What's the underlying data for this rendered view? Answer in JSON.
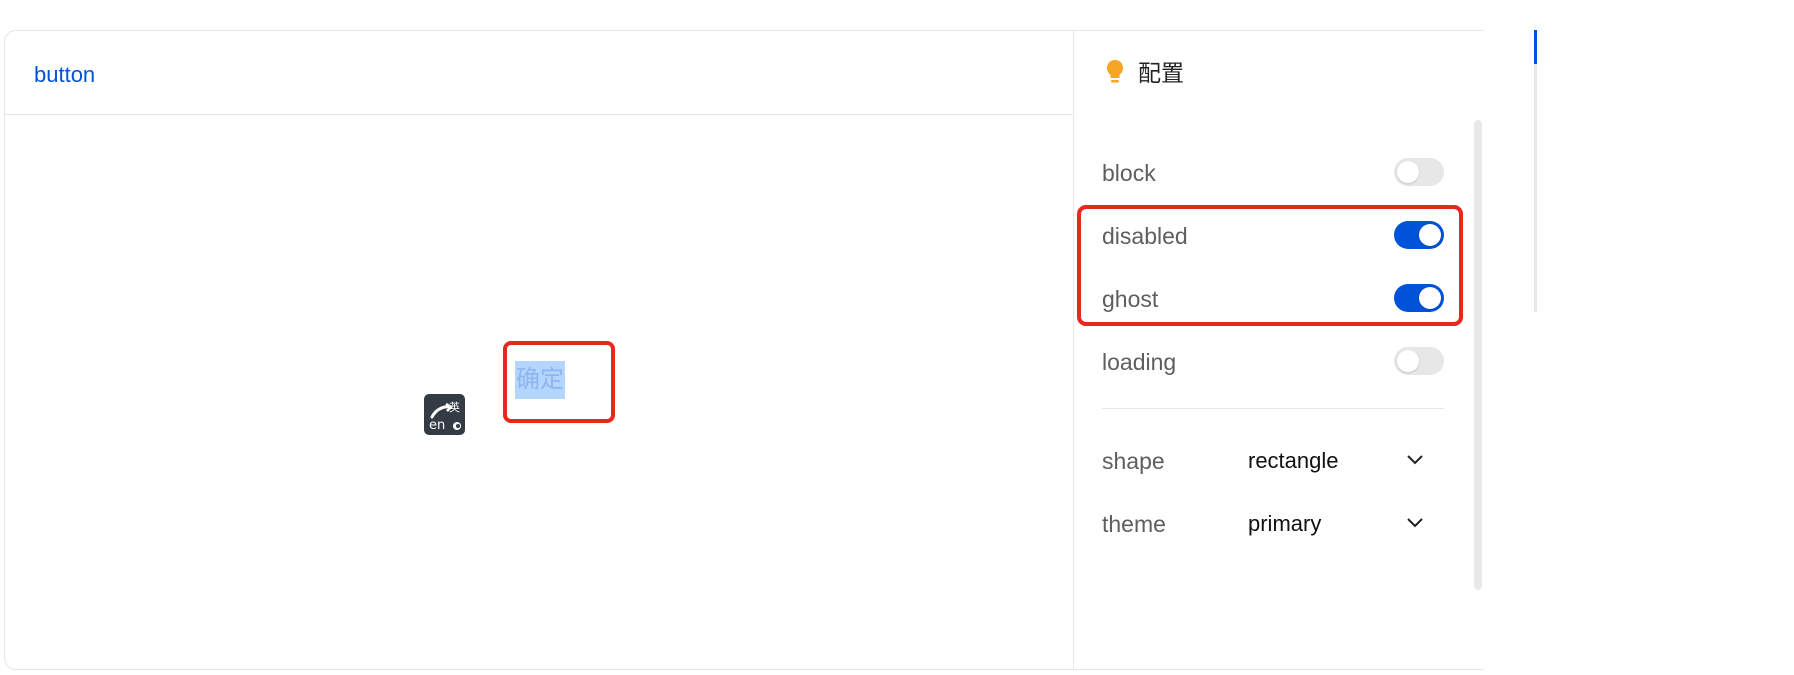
{
  "demo": {
    "title": "button",
    "preview_button_label": "确定"
  },
  "config": {
    "title": "配置",
    "icon": "lightbulb-icon",
    "toggles": [
      {
        "label": "block",
        "checked": false
      },
      {
        "label": "disabled",
        "checked": true
      },
      {
        "label": "ghost",
        "checked": true
      },
      {
        "label": "loading",
        "checked": false
      }
    ],
    "selects": [
      {
        "label": "shape",
        "value": "rectangle"
      },
      {
        "label": "theme",
        "value": "primary"
      }
    ]
  },
  "anchor": {
    "items": [
      "",
      "",
      "",
      "",
      "",
      "",
      ""
    ]
  },
  "colors": {
    "brand": "#0052d9",
    "highlight": "#e8271f",
    "bulb": "#f5a623",
    "selection": "#b4d5fe"
  }
}
